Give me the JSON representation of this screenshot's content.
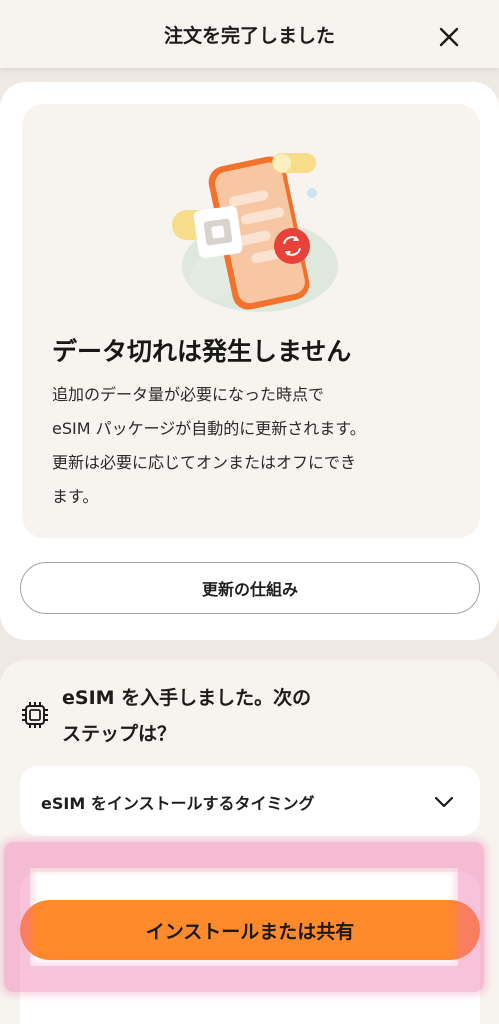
{
  "header": {
    "title": "注文を完了しました",
    "close_icon": "close-icon"
  },
  "info_card": {
    "illustration_icon": "phone-esim-refresh-icon",
    "title": "データ切れは発生しません",
    "description_lines": [
      "追加のデータ量が必要になった時点で",
      "eSIM パッケージが自動的に更新されます。",
      "更新は必要に応じてオンまたはオフにでき",
      "ます。"
    ],
    "button_label": "更新の仕組み"
  },
  "next_steps": {
    "icon": "chip-icon",
    "title_lines": [
      "eSIM を入手しました。次の",
      "ステップは？"
    ],
    "accordion_label": "eSIM をインストールするタイミング",
    "accordion_icon": "chevron-down-icon"
  },
  "primary_button": {
    "label": "インストールまたは共有"
  },
  "colors": {
    "background": "#efe9e3",
    "card": "#ffffff",
    "card_inner": "#f7f3ef",
    "accent_orange": "#ff8a2b",
    "refresh_red": "#e8413a",
    "highlight_pink": "#f06eaa"
  }
}
